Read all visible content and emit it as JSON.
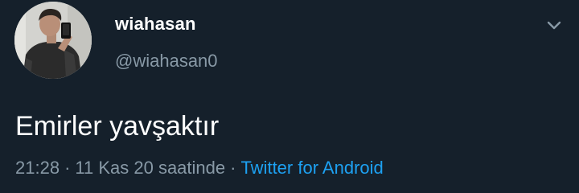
{
  "tweet": {
    "display_name": "wiahasan",
    "handle": "@wiahasan0",
    "text": "Emirler yavşaktır",
    "time": "21:28",
    "separator": "·",
    "date": "11 Kas 20 saatinde",
    "source": "Twitter for Android"
  },
  "icons": {
    "menu": "chevron-down-icon",
    "avatar": "profile-photo"
  },
  "colors": {
    "background": "#15202b",
    "text": "#ffffff",
    "secondary": "#8899a6",
    "link": "#1da1f2"
  }
}
